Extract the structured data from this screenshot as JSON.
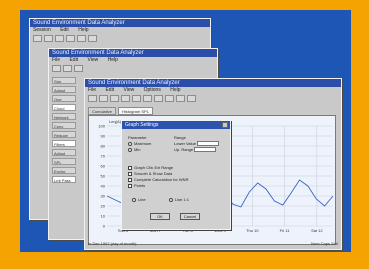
{
  "windows": {
    "back": {
      "title": "Sound Environment Data Analyzer",
      "menu": [
        "Session",
        "Edit",
        "Help"
      ]
    },
    "middle": {
      "title": "Sound Environment Data Analyzer",
      "menu": [
        "File",
        "Edit",
        "View",
        "Help"
      ],
      "sidebar": [
        "Stor",
        "Adjust",
        "Ope",
        "Cloud",
        "Network",
        "Conv",
        "Reduce",
        "Filters",
        "Adjust",
        "SPL",
        "Enviro",
        "Lmt Pass"
      ]
    },
    "front": {
      "title": "Sound Environment Data Analyzer",
      "menu": [
        "File",
        "Edit",
        "View",
        "Options",
        "Help"
      ],
      "tabs": [
        "Cumulative",
        "Histogram SPL"
      ],
      "status_left": "In Dec 1997 (day of month)",
      "status_right": "Num Caps Scrl"
    }
  },
  "dialog": {
    "title": "Graph Settings",
    "group_left_label": "Parameter",
    "group_right_label": "Range",
    "radio_left": [
      "Maximum",
      "Min"
    ],
    "range_rows": [
      "Lower Value",
      "Up. Range"
    ],
    "check_options": [
      "Graph Chk Ext Range",
      "Smooth & Show Data",
      "Complete Calculation for WNR",
      "Points"
    ],
    "bottom_radios": [
      "Line",
      "Line 1:1"
    ],
    "ok_label": "OK",
    "cancel_label": "Cancel"
  },
  "chart_data": {
    "type": "line",
    "ylabel": "Leq(A)",
    "ylim": [
      0,
      100
    ],
    "y_ticks": [
      "100",
      "90",
      "80",
      "70",
      "60",
      "50",
      "40",
      "30",
      "20",
      "10",
      "0"
    ],
    "categories": [
      "Sun 6",
      "Mon 7",
      "Tue 8",
      "Wed 9",
      "Thu 10",
      "Fri 11",
      "Sat 12"
    ],
    "series": [
      {
        "values": [
          30,
          26,
          22,
          35,
          42,
          28,
          20,
          33,
          45,
          38,
          24,
          18,
          31,
          44,
          36,
          22,
          19,
          34,
          43,
          37,
          25,
          21,
          33,
          46,
          40,
          27,
          20,
          30
        ]
      }
    ]
  },
  "colors": {
    "frame": "#f4a300",
    "desktop": "#1e56b5",
    "titlebar": "#2b4fa8",
    "line": "#3b63c4"
  }
}
